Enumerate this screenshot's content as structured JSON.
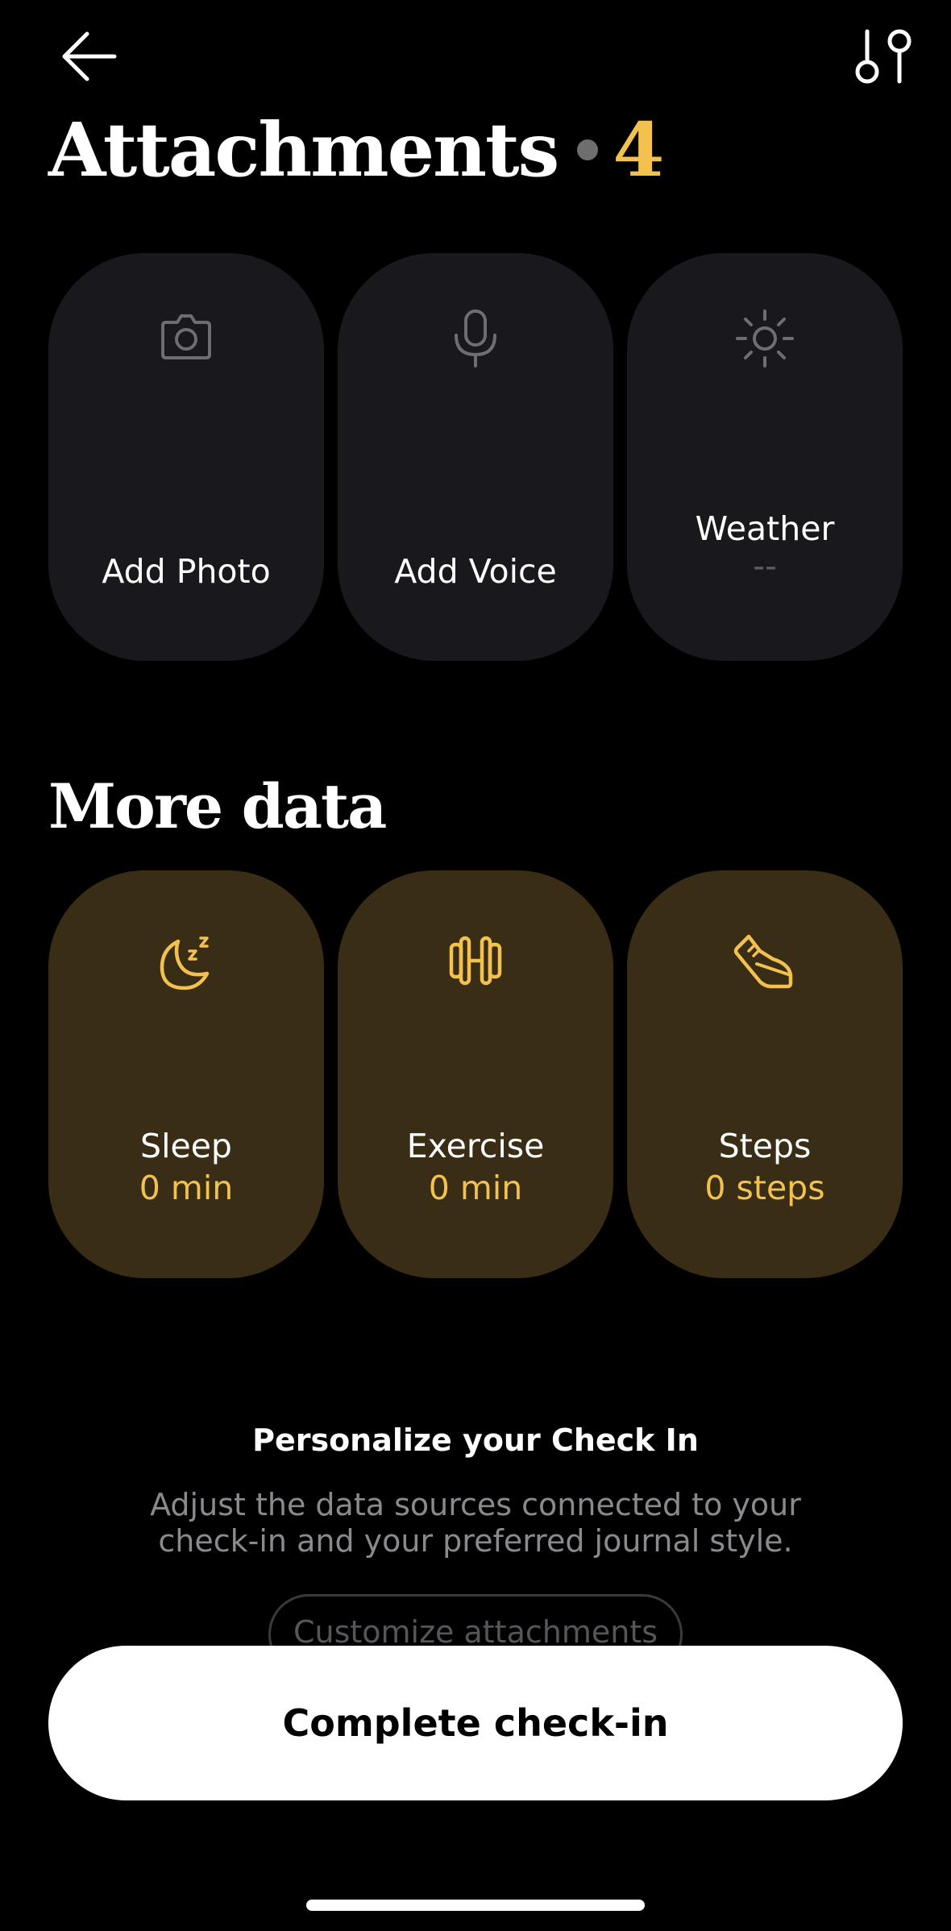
{
  "header": {
    "back_icon": "arrow-left-icon",
    "filter_icon": "sliders-icon"
  },
  "attachments": {
    "title": "Attachments",
    "count": "4",
    "tiles": [
      {
        "icon": "camera-icon",
        "label": "Add Photo"
      },
      {
        "icon": "microphone-icon",
        "label": "Add Voice"
      },
      {
        "icon": "sun-icon",
        "label": "Weather",
        "value": "--"
      }
    ]
  },
  "more_data": {
    "title": "More data",
    "tiles": [
      {
        "icon": "moon-sleep-icon",
        "label": "Sleep",
        "value": "0 min"
      },
      {
        "icon": "dumbbell-icon",
        "label": "Exercise",
        "value": "0 min"
      },
      {
        "icon": "shoe-icon",
        "label": "Steps",
        "value": "0 steps"
      }
    ]
  },
  "personalize": {
    "title": "Personalize your Check In",
    "description_line1": "Adjust the data sources connected to your",
    "description_line2": "check-in and your preferred journal style.",
    "customize_label": "Customize attachments"
  },
  "footer": {
    "complete_label": "Complete check-in"
  },
  "colors": {
    "accent": "#f2c14e",
    "tile_dark": "#19181c",
    "tile_gold": "#392d15",
    "background": "#000000"
  }
}
